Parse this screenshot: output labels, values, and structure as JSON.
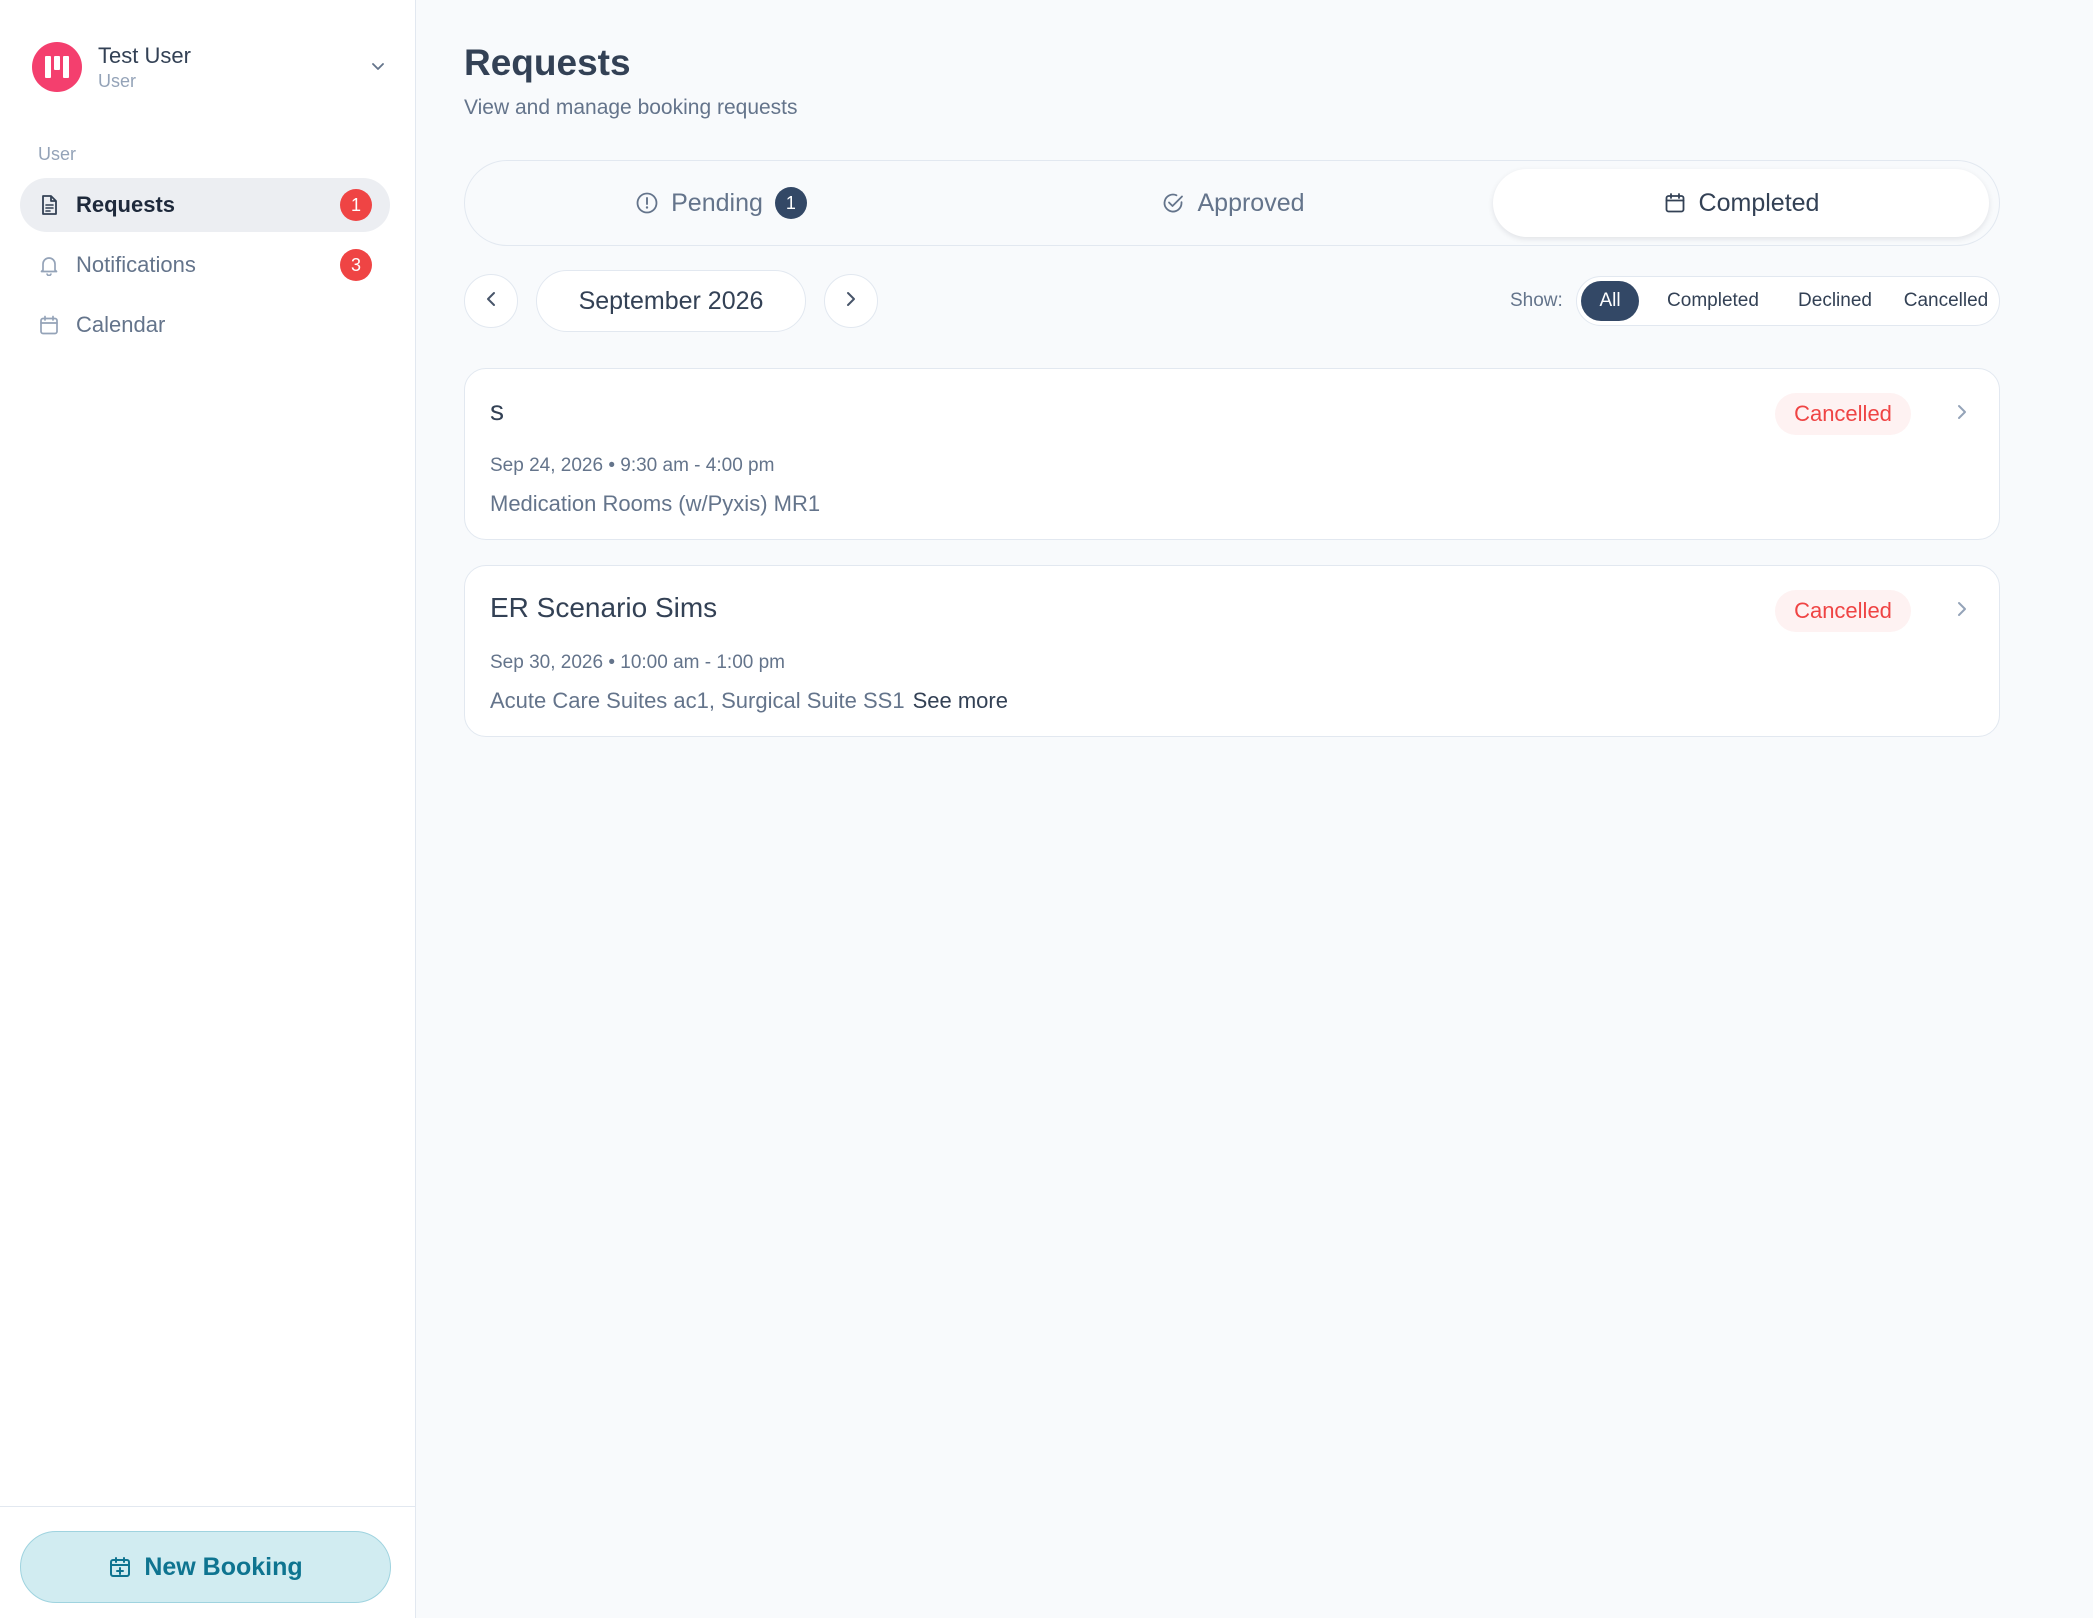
{
  "user": {
    "name": "Test User",
    "role": "User"
  },
  "sidebar": {
    "section_label": "User",
    "items": [
      {
        "label": "Requests",
        "icon": "document-icon",
        "badge": "1",
        "active": true
      },
      {
        "label": "Notifications",
        "icon": "bell-icon",
        "badge": "3",
        "active": false
      },
      {
        "label": "Calendar",
        "icon": "calendar-icon",
        "badge": null,
        "active": false
      }
    ],
    "new_booking_label": "New Booking"
  },
  "page": {
    "title": "Requests",
    "subtitle": "View and manage booking requests"
  },
  "tabs": [
    {
      "label": "Pending",
      "icon": "alert-circle-icon",
      "badge": "1",
      "active": false
    },
    {
      "label": "Approved",
      "icon": "check-circle-icon",
      "badge": null,
      "active": false
    },
    {
      "label": "Completed",
      "icon": "calendar-icon",
      "badge": null,
      "active": true
    }
  ],
  "month_nav": {
    "label": "September 2026"
  },
  "filters": {
    "label": "Show:",
    "options": [
      "All",
      "Completed",
      "Declined",
      "Cancelled"
    ],
    "selected": "All"
  },
  "requests": [
    {
      "title": "s",
      "when": "Sep 24, 2026 • 9:30 am - 4:00 pm",
      "where": "Medication Rooms (w/Pyxis) MR1",
      "see_more": "",
      "status": "Cancelled"
    },
    {
      "title": "ER Scenario Sims",
      "when": "Sep 30, 2026 • 10:00 am - 1:00 pm",
      "where": "Acute Care Suites ac1, Surgical Suite SS1",
      "see_more": "See more",
      "status": "Cancelled"
    }
  ],
  "colors": {
    "accent_dark": "#334866",
    "badge_red": "#ef4444",
    "booking_bg": "#d1ecf1",
    "booking_text": "#0e7490",
    "avatar": "#f43f6e"
  }
}
